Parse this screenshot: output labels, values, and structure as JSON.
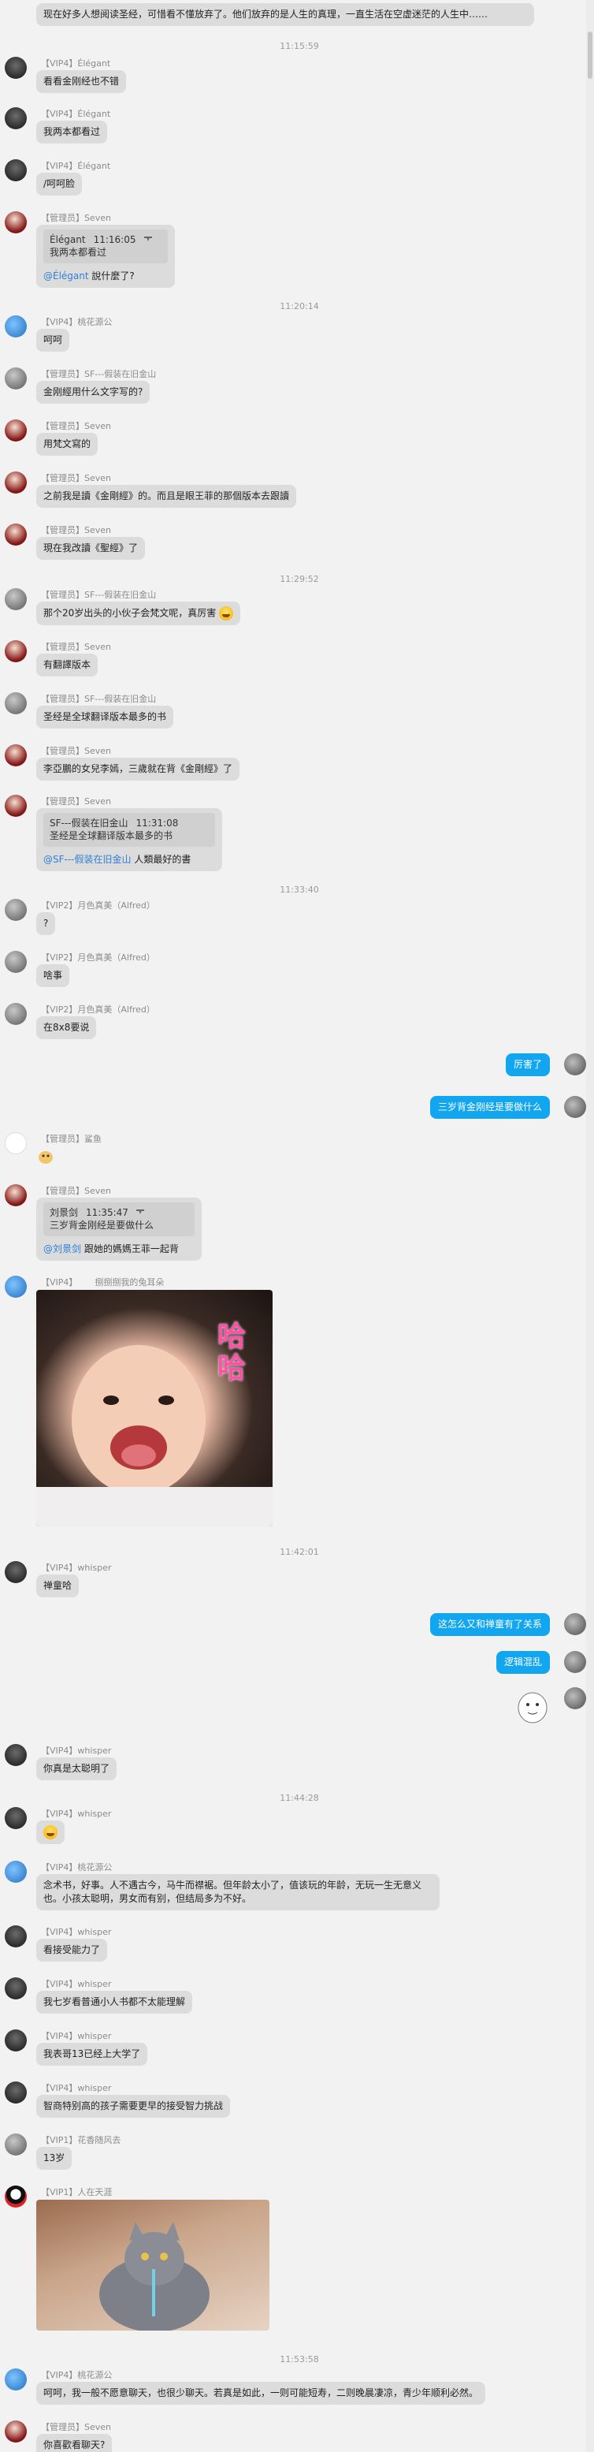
{
  "top_message": {
    "text": "现在好多人想阅读圣经，可惜看不懂放弃了。他们放弃的是人生的真理，一直生活在空虚迷茫的人生中……"
  },
  "times": [
    "11:15:59",
    "11:20:14",
    "11:29:52",
    "11:33:40",
    "11:42:01",
    "11:44:28",
    "11:53:58"
  ],
  "messages": [
    {
      "sender": "【VIP4】Élégant",
      "text": "看看金刚经也不错"
    },
    {
      "sender": "【VIP4】Élégant",
      "text": "我两本都看过"
    },
    {
      "sender": "【VIP4】Élégant",
      "text": "/呵呵脸"
    },
    {
      "sender": "【管理员】Seven",
      "quote_name": "Élégant",
      "quote_time": "11:16:05",
      "quote_text": "我两本都看过",
      "mention": "@Élégant",
      "text": " 說什麼了?"
    },
    {
      "sender": "【VIP4】桃花源公",
      "text": "呵呵"
    },
    {
      "sender": "【管理员】SF---假装在旧金山",
      "text": "金刚經用什么文字写的?"
    },
    {
      "sender": "【管理员】Seven",
      "text": "用梵文寫的"
    },
    {
      "sender": "【管理员】Seven",
      "text": "之前我是讀《金剛經》的。而且是眼王菲的那個版本去跟讀"
    },
    {
      "sender": "【管理员】Seven",
      "text": "現在我改讀《聖經》了"
    },
    {
      "sender": "【管理员】SF---假装在旧金山",
      "text": "那个20岁出头的小伙子会梵文呢，真厉害"
    },
    {
      "sender": "【管理员】Seven",
      "text": "有翻譯版本"
    },
    {
      "sender": "【管理员】SF---假装在旧金山",
      "text": "圣经是全球翻译版本最多的书"
    },
    {
      "sender": "【管理员】Seven",
      "text": "李亞鵬的女兒李嫣，三歲就在背《金剛經》了"
    },
    {
      "sender": "【管理员】Seven",
      "quote_name": "SF---假装在旧金山",
      "quote_time": "11:31:08",
      "quote_text": "圣经是全球翻译版本最多的书",
      "mention": "@SF---假装在旧金山",
      "text": " 人類最好的書"
    },
    {
      "sender": "【VIP2】月色真美（Alfred）",
      "text": "?"
    },
    {
      "sender": "【VIP2】月色真美（Alfred）",
      "text": "啥事"
    },
    {
      "sender": "【VIP2】月色真美（Alfred）",
      "text": "在8x8要说"
    },
    {
      "sender": "【管理员】鲨鱼"
    },
    {
      "sender": "【管理员】Seven",
      "quote_name": "刘景剑",
      "quote_time": "11:35:47",
      "quote_text": "三岁背金刚经是要做什么",
      "mention": "@刘景剑",
      "text": " 跟她的媽媽王菲一起背"
    },
    {
      "sender": "【VIP4】",
      "sub": "捌捌捌我的兔耳朵"
    },
    {
      "sender": "【VIP4】whisper",
      "text": "禅童哈"
    },
    {
      "sender": "【VIP4】whisper",
      "text": "你真是太聪明了"
    },
    {
      "sender": "【VIP4】whisper"
    },
    {
      "sender": "【VIP4】桃花源公",
      "text": "念术书，好事。人不遇古今，马牛而襟裾。但年龄太小了，值该玩的年龄，无玩一生无意义也。小孩太聪明，男女而有别，但结局多为不好。"
    },
    {
      "sender": "【VIP4】whisper",
      "text": "看接受能力了"
    },
    {
      "sender": "【VIP4】whisper",
      "text": "我七岁看普通小人书都不太能理解"
    },
    {
      "sender": "【VIP4】whisper",
      "text": "我表哥13已经上大学了"
    },
    {
      "sender": "【VIP4】whisper",
      "text": "智商特别高的孩子需要更早的接受智力挑战"
    },
    {
      "sender": "【VIP1】花香随风去",
      "text": "13岁"
    },
    {
      "sender": "【VIP1】人在天涯"
    },
    {
      "sender": "【VIP4】桃花源公",
      "text": "呵呵，我一般不愿意聊天，也很少聊天。若真是如此，一则可能短寿，二则晚晨凄凉，青少年顺利必然。"
    },
    {
      "sender": "【管理员】Seven",
      "text": "你喜歡看聊天?"
    }
  ],
  "self_messages": [
    "厉害了",
    "三岁背金刚经是要做什么",
    "这怎么又和禅童有了关系",
    "逻辑混乱"
  ],
  "stickers": {
    "baby_caption": "哈哈"
  },
  "colors": {
    "self_bubble": "#12a6f0",
    "other_bubble": "#dcdcdc",
    "mention": "#2f7fd8"
  },
  "icons": [
    "user-avatar-icon",
    "smiley-emoji-icon",
    "pin-icon"
  ]
}
